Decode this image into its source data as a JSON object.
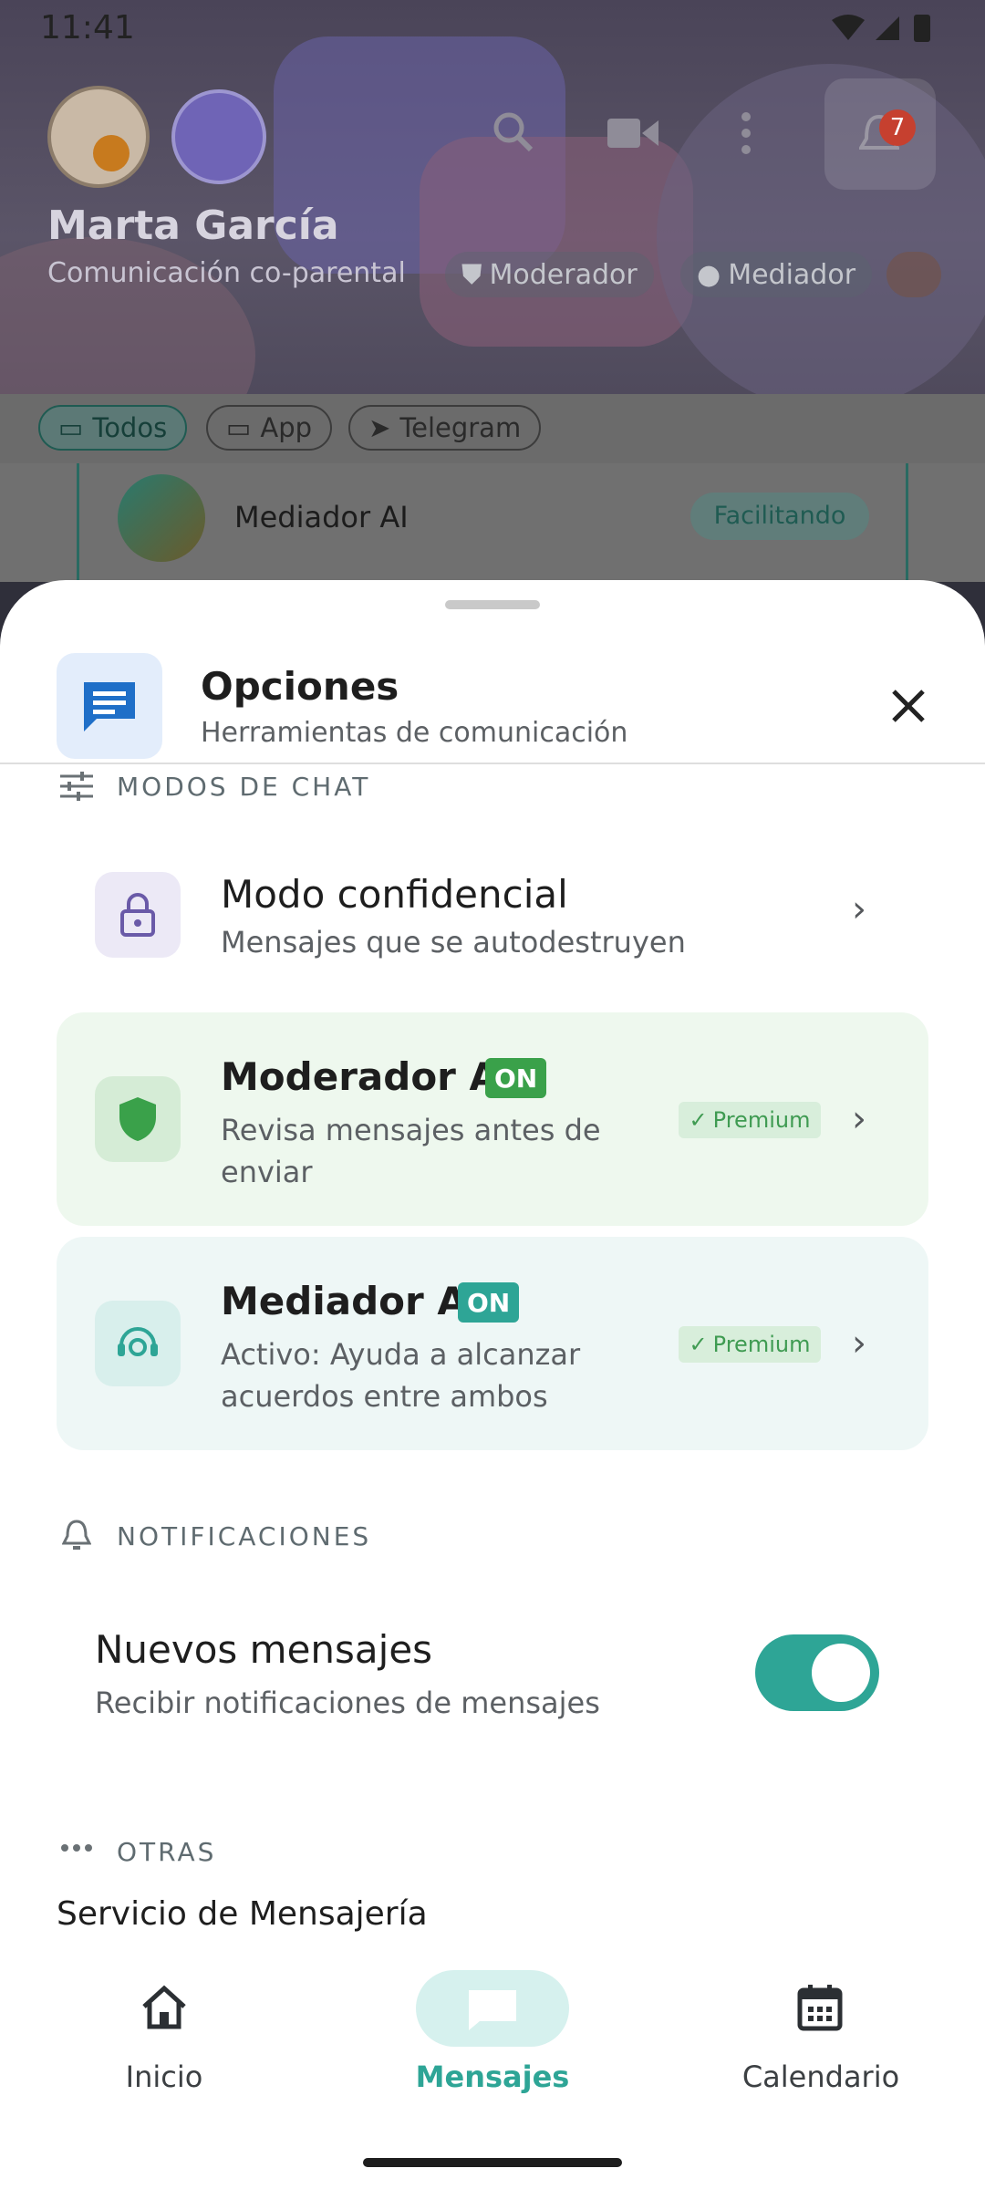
{
  "status_bar": {
    "time": "11:41"
  },
  "profile": {
    "name": "Marta García",
    "subtitle": "Comunicación co-parental",
    "roles": [
      "Moderador",
      "Mediador"
    ],
    "notification_count": "7"
  },
  "filters": [
    "Todos",
    "App",
    "Telegram"
  ],
  "background_chat": {
    "name": "Mediador AI",
    "status": "Facilitando"
  },
  "sheet": {
    "title": "Opciones",
    "subtitle": "Herramientas de comunicación",
    "sections": {
      "chat_modes": "MODOS DE CHAT",
      "notifications": "NOTIFICACIONES",
      "other": "OTRAS"
    },
    "confidential": {
      "title": "Modo confidencial",
      "desc": "Mensajes que se autodestruyen"
    },
    "moderator": {
      "title": "Moderador AI",
      "badge": "ON",
      "desc_line1": "Revisa mensajes antes de",
      "desc_line2": "enviar",
      "premium": "Premium"
    },
    "mediator": {
      "title": "Mediador AI",
      "badge": "ON",
      "desc_line1": "Activo: Ayuda a alcanzar",
      "desc_line2": "acuerdos entre ambos",
      "premium": "Premium"
    },
    "new_messages": {
      "title": "Nuevos mensajes",
      "desc": "Recibir notificaciones de mensajes",
      "enabled": true
    },
    "messaging_service": "Servicio de Mensajería"
  },
  "bottom_nav": {
    "home": "Inicio",
    "messages": "Mensajes",
    "calendar": "Calendario"
  },
  "colors": {
    "accent": "#2ea596",
    "moderator_green": "#3aa14a",
    "premium_bg": "#d8eedb"
  }
}
